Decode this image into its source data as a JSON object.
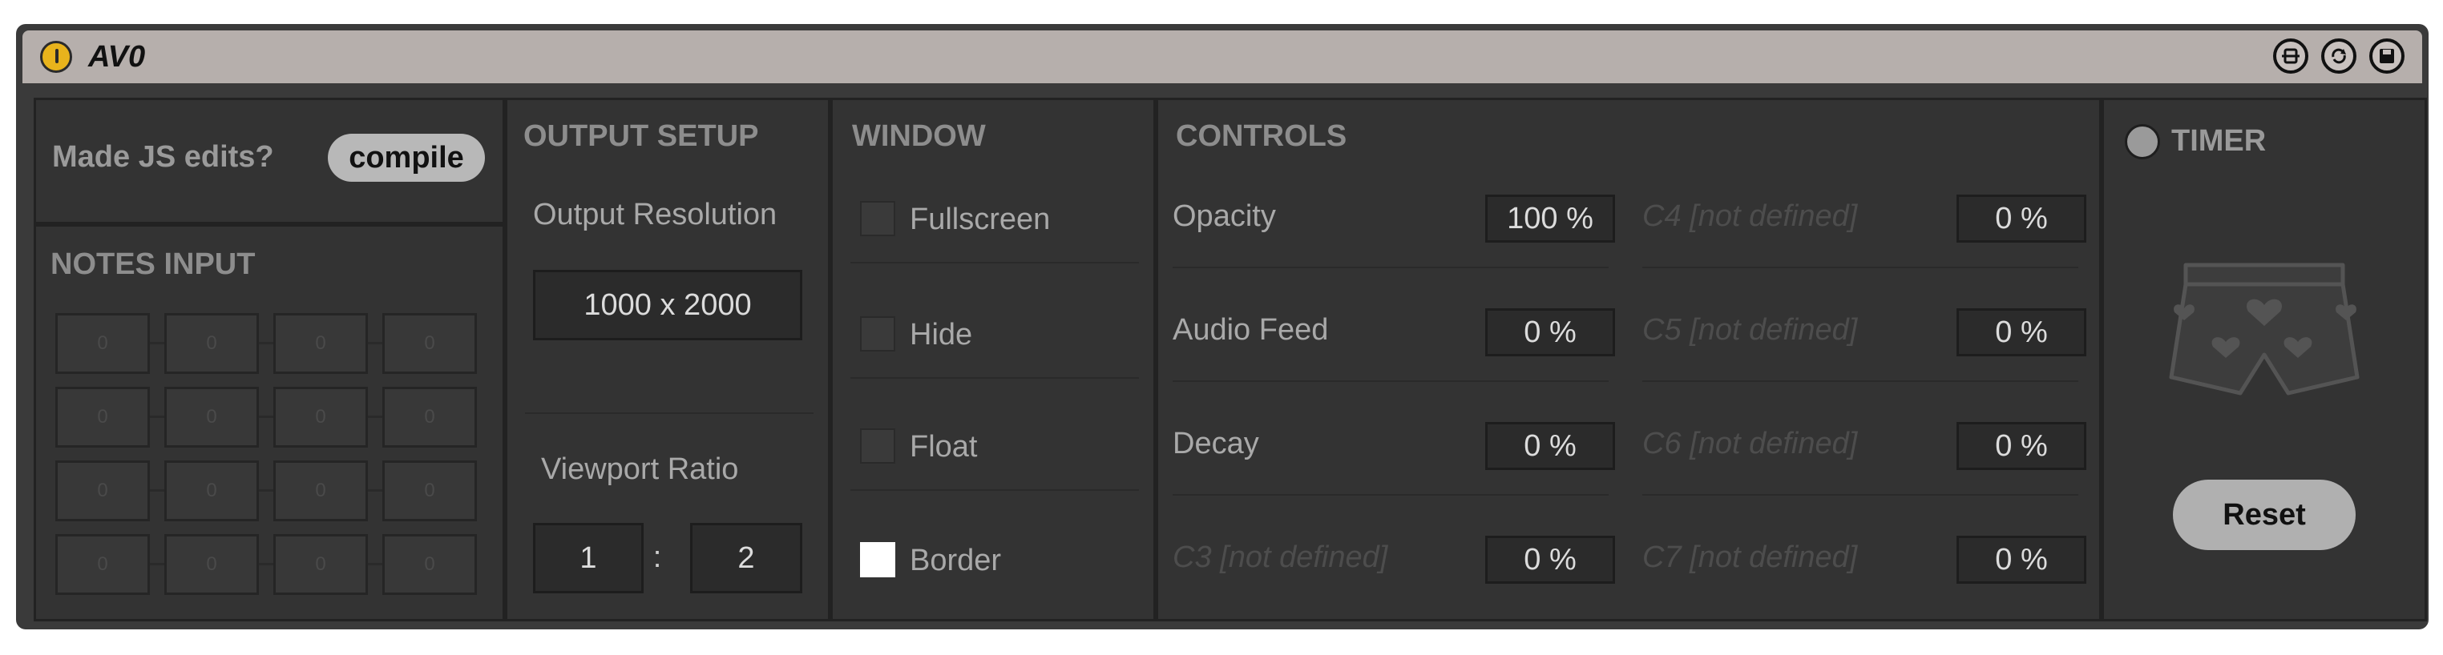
{
  "device": {
    "title": "AV0"
  },
  "titlebar_icons": [
    "hotswap-icon",
    "refresh-icon",
    "save-icon"
  ],
  "compile": {
    "prompt": "Made JS edits?",
    "button": "compile"
  },
  "notes": {
    "header": "NOTES INPUT",
    "cells": [
      "0",
      "0",
      "0",
      "0",
      "0",
      "0",
      "0",
      "0",
      "0",
      "0",
      "0",
      "0",
      "0",
      "0",
      "0",
      "0"
    ]
  },
  "output": {
    "header": "OUTPUT SETUP",
    "resolution_label": "Output Resolution",
    "resolution_value": "1000 x 2000",
    "ratio_label": "Viewport Ratio",
    "ratio_w": "1",
    "ratio_sep": ":",
    "ratio_h": "2"
  },
  "window": {
    "header": "WINDOW",
    "options": [
      {
        "label": "Fullscreen",
        "checked": false
      },
      {
        "label": "Hide",
        "checked": false
      },
      {
        "label": "Float",
        "checked": false
      },
      {
        "label": "Border",
        "checked": true
      }
    ]
  },
  "controls": {
    "header": "CONTROLS",
    "left": [
      {
        "label": "Opacity",
        "value": "100 %",
        "defined": true
      },
      {
        "label": "Audio Feed",
        "value": "0 %",
        "defined": true
      },
      {
        "label": "Decay",
        "value": "0 %",
        "defined": true
      },
      {
        "label": "C3 [not defined]",
        "value": "0 %",
        "defined": false
      }
    ],
    "right": [
      {
        "label": "C4 [not defined]",
        "value": "0 %",
        "defined": false
      },
      {
        "label": "C5 [not defined]",
        "value": "0 %",
        "defined": false
      },
      {
        "label": "C6 [not defined]",
        "value": "0 %",
        "defined": false
      },
      {
        "label": "C7 [not defined]",
        "value": "0 %",
        "defined": false
      }
    ]
  },
  "timer": {
    "label": "TIMER",
    "reset": "Reset",
    "logo": "shorts-hearts-icon"
  },
  "colors": {
    "power": "#e8b31c",
    "titlebar": "#b6afac",
    "panel": "#333333",
    "frame": "#3a3a3a"
  }
}
